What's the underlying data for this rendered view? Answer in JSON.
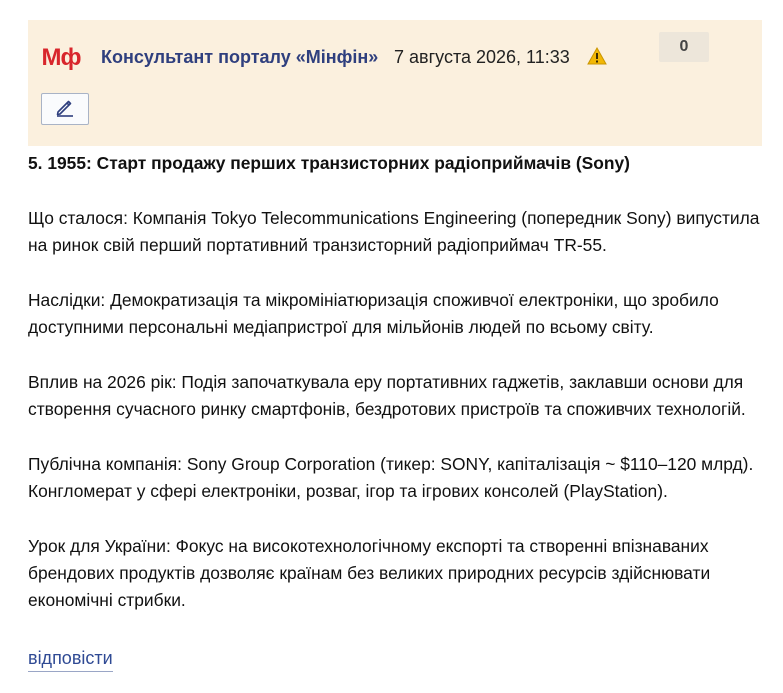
{
  "post": {
    "logo_text": "Мф",
    "author": "Консультант порталу «Мінфін»",
    "date": "7 августа 2026, 11:33",
    "score": "0",
    "title": "5. 1955: Старт продажу перших транзисторних радіоприймачів (Sony)",
    "paragraphs": [
      "Що сталося: Компанія Tokyo Telecommunications Engineering (попередник Sony) випустила на ринок свій перший портативний транзисторний радіоприймач TR-55.",
      "Наслідки: Демократизація та мікромініатюризація споживчої електроніки, що зробило доступними персональні медіапристрої для мільйонів людей по всьому світу.",
      "Вплив на 2026 рік: Подія започаткувала еру портативних гаджетів, заклавши основи для створення сучасного ринку смартфонів, бездротових пристроїв та споживчих технологій.",
      "Публічна компанія: Sony Group Corporation (тикер: SONY, капіталізація ~ $110–120 млрд). Конгломерат у сфері електроніки, розваг, ігор та ігрових консолей (PlayStation).",
      "Урок для України: Фокус на високотехнологічному експорті та створенні впізнаваних брендових продуктів дозволяє країнам без великих природних ресурсів здійснювати економічні стрибки."
    ],
    "reply_label": "відповісти"
  },
  "icons": {
    "warning": "warning-icon",
    "edit": "pencil-icon"
  },
  "colors": {
    "header_bg": "#fbf0de",
    "author": "#2f3f7e",
    "logo": "#d8262c",
    "link": "#2f4a94",
    "warning": "#f2b705"
  }
}
